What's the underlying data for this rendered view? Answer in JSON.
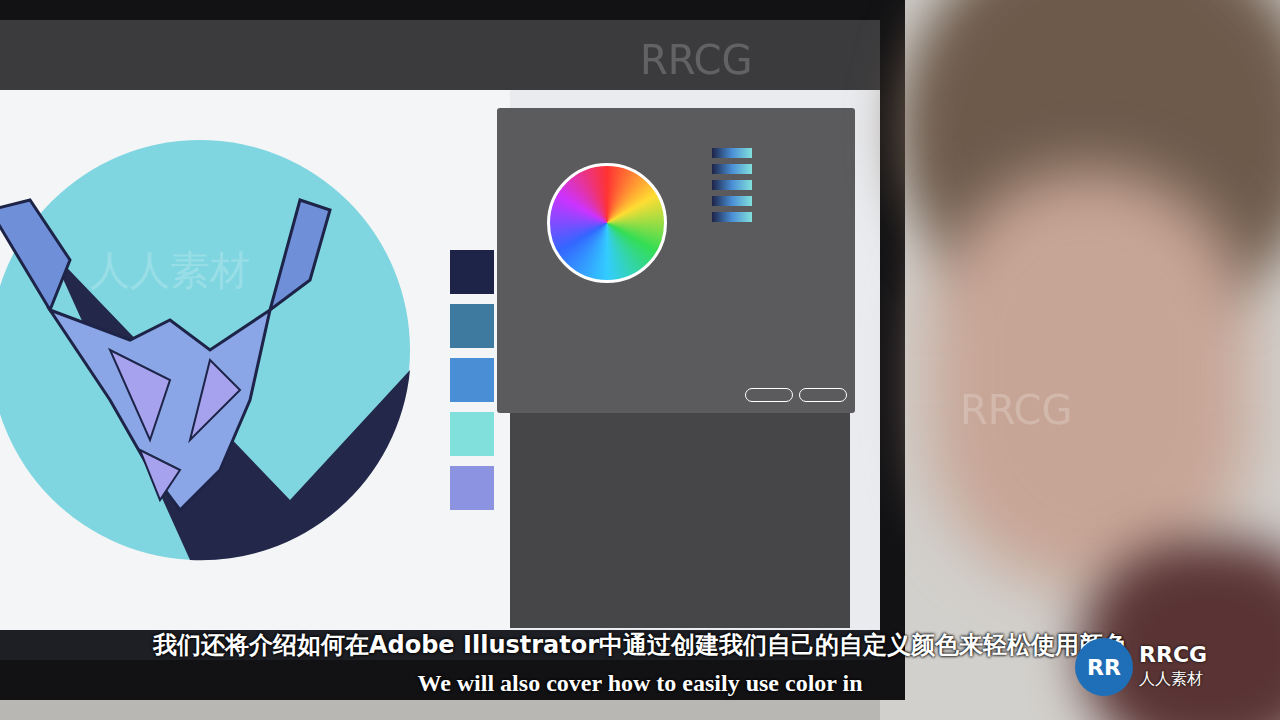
{
  "subtitles": {
    "zh": "我们还将介绍如何在Adobe Illustrator中通过创建我们自己的自定义颜色来轻松使用颜色",
    "en": "We will also cover how to easily use color in"
  },
  "logo": {
    "mark": "RR",
    "name": "RRCG",
    "sub": "人人素材"
  },
  "watermarks": [
    "RRCG",
    "人人素材"
  ]
}
